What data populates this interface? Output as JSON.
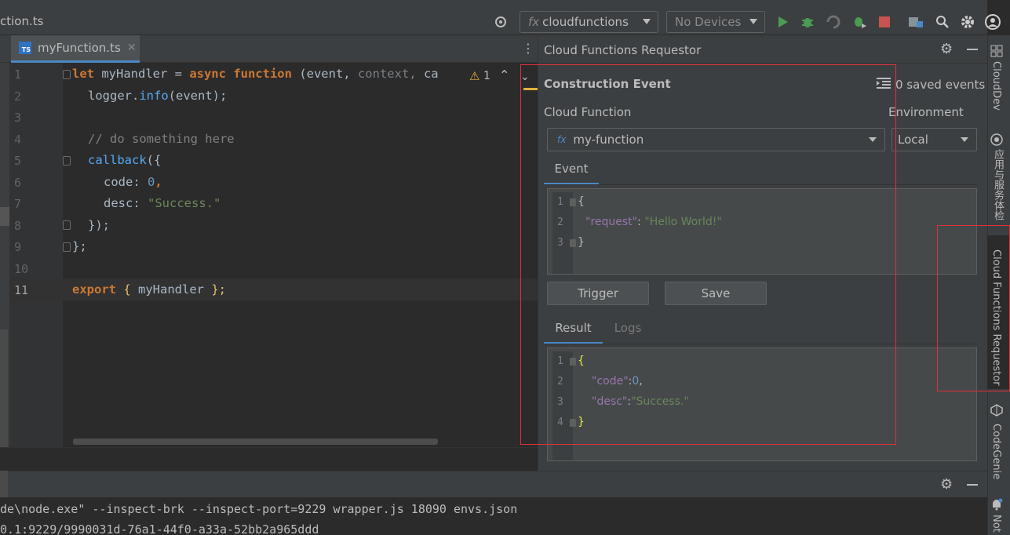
{
  "topbar": {
    "file_title": "ction.ts",
    "run_config": "cloudfunctions",
    "devices": "No Devices"
  },
  "editor": {
    "tab_label": "myFunction.ts",
    "tab_badge": "TS",
    "line_numbers": [
      "1",
      "2",
      "3",
      "4",
      "5",
      "6",
      "7",
      "8",
      "9",
      "10",
      "11"
    ],
    "warning_count": "1",
    "lines": {
      "l1_let": "let ",
      "l1_name": "myHandler = ",
      "l1_async": "async ",
      "l1_function": "function ",
      "l1_paren": "(event, ",
      "l1_context": "context, ",
      "l1_ca": "ca",
      "l2_logger": "logger",
      "l2_dot": ".",
      "l2_info": "info",
      "l2_rest": "(event);",
      "l4_comment": "// do something here",
      "l5_callback": "callback",
      "l5_rest": "({",
      "l6_key": "code: ",
      "l6_val": "0",
      "l6_comma": ",",
      "l7_key": "desc: ",
      "l7_val": "\"Success.\"",
      "l8": "});",
      "l9": "};",
      "l11_export": "export ",
      "l11_open": "{ ",
      "l11_name": "myHandler ",
      "l11_close": "};"
    }
  },
  "panel": {
    "title": "Cloud Functions Requestor",
    "construction_title": "Construction Event",
    "saved_events": "0 saved events",
    "cloud_function_label": "Cloud Function",
    "environment_label": "Environment",
    "function_prefix": "fx",
    "function_value": "my-function",
    "environment_value": "Local",
    "event_tab": "Event",
    "event_json": {
      "line_numbers": [
        "1",
        "2",
        "3"
      ],
      "open": "{",
      "key": "\"request\"",
      "colon": ": ",
      "value": "\"Hello World!\"",
      "close": "}"
    },
    "trigger_label": "Trigger",
    "save_label": "Save",
    "result_tab": "Result",
    "logs_tab": "Logs",
    "result_json": {
      "line_numbers": [
        "1",
        "2",
        "3",
        "4"
      ],
      "open": "{",
      "code_key": "\"code\"",
      "code_colon": ":",
      "code_value": "0",
      "code_comma": ",",
      "desc_key": "\"desc\"",
      "desc_colon": ":",
      "desc_value": "\"Success.\"",
      "close": "}"
    }
  },
  "right_strip": {
    "cloud_dev": "CloudDev",
    "app_services": "应用与服务体检",
    "cfr": "Cloud Functions Requestor",
    "codegenie": "CodeGenie",
    "notifications": "Not"
  },
  "console": {
    "line1": "de\\node.exe\" --inspect-brk --inspect-port=9229 wrapper.js 18090 envs.json",
    "line2": "0.1:9229/9990031d-76a1-44f0-a33a-52bb2a965ddd"
  },
  "colors": {
    "accent": "#4a88c7",
    "highlight_red": "#e0313a",
    "run_green": "#499c54",
    "stop_red": "#c75450"
  }
}
